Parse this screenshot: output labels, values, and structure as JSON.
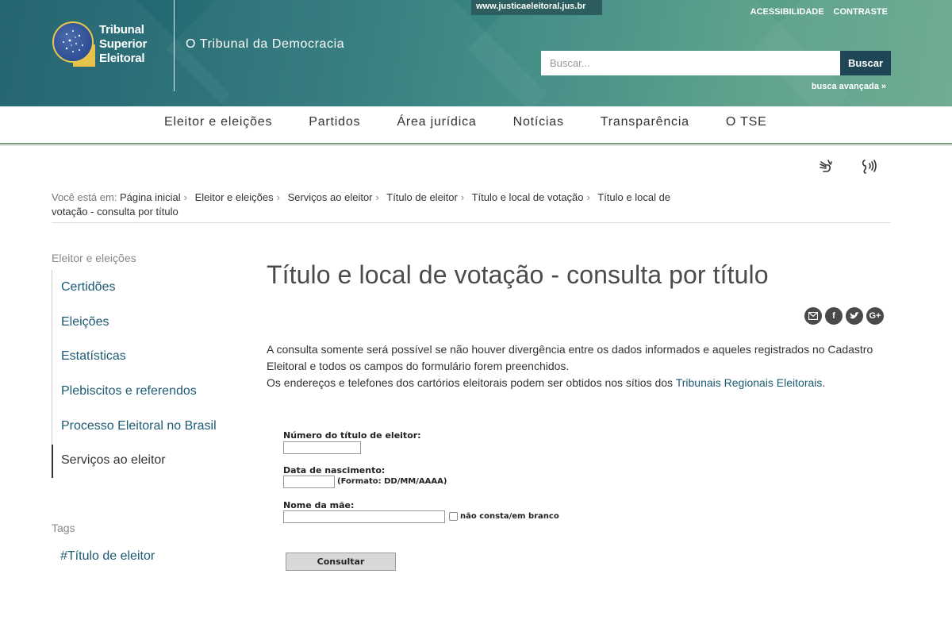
{
  "header": {
    "logo_lines": [
      "Tribunal",
      "Superior",
      "Eleitoral"
    ],
    "tagline": "O Tribunal da Democracia",
    "site_link": "www.justicaeleitoral.jus.br",
    "top_links": [
      "ACESSIBILIDADE",
      "CONTRASTE"
    ],
    "search_placeholder": "Buscar...",
    "search_button": "Buscar",
    "advanced_search": "busca avançada »"
  },
  "nav": {
    "items": [
      "Eleitor e eleições",
      "Partidos",
      "Área jurídica",
      "Notícias",
      "Transparência",
      "O TSE"
    ]
  },
  "accessibility_icons": [
    "sign-language-icon",
    "audio-description-icon"
  ],
  "breadcrumb": {
    "prefix": "Você está em:",
    "items": [
      "Página inicial",
      "Eleitor e eleições",
      "Serviços ao eleitor",
      "Título de eleitor",
      "Título e local de votação"
    ],
    "current": "Título e local de votação - consulta por título"
  },
  "sidebar": {
    "heading": "Eleitor e eleições",
    "items": [
      "Certidões",
      "Eleições",
      "Estatísticas",
      "Plebiscitos e referendos",
      "Processo Eleitoral no Brasil",
      "Serviços ao eleitor"
    ],
    "active_index": 5,
    "tags_heading": "Tags",
    "tags": [
      "#Título de eleitor"
    ]
  },
  "content": {
    "title": "Título e local de votação - consulta por título",
    "share_icons": [
      "email-icon",
      "facebook-icon",
      "twitter-icon",
      "google-plus-icon"
    ],
    "intro_line1": "A consulta somente será possível se não houver divergência entre os dados informados e aqueles registrados no Cadastro Eleitoral e todos os campos do formulário forem preenchidos.",
    "intro_line2_prefix": "Os endereços e telefones dos cartórios eleitorais podem ser obtidos nos sítios dos",
    "intro_link": "Tribunais Regionais Eleitorais",
    "intro_line2_suffix": "."
  },
  "form": {
    "title_number_label": "Número do título de eleitor:",
    "title_number_value": "",
    "birth_label": "Data de nascimento:",
    "birth_value": "",
    "birth_hint": "(Formato: DD/MM/AAAA)",
    "mother_label": "Nome da mãe:",
    "mother_value": "",
    "mother_checkbox_label": "não consta/em branco",
    "submit": "Consultar"
  },
  "colors": {
    "header_gradient_start": "#1d5f6c",
    "header_gradient_end": "#6aa98d",
    "search_button": "#1e4656",
    "link": "#1c5a73",
    "logo_gold": "#e9c84e"
  }
}
